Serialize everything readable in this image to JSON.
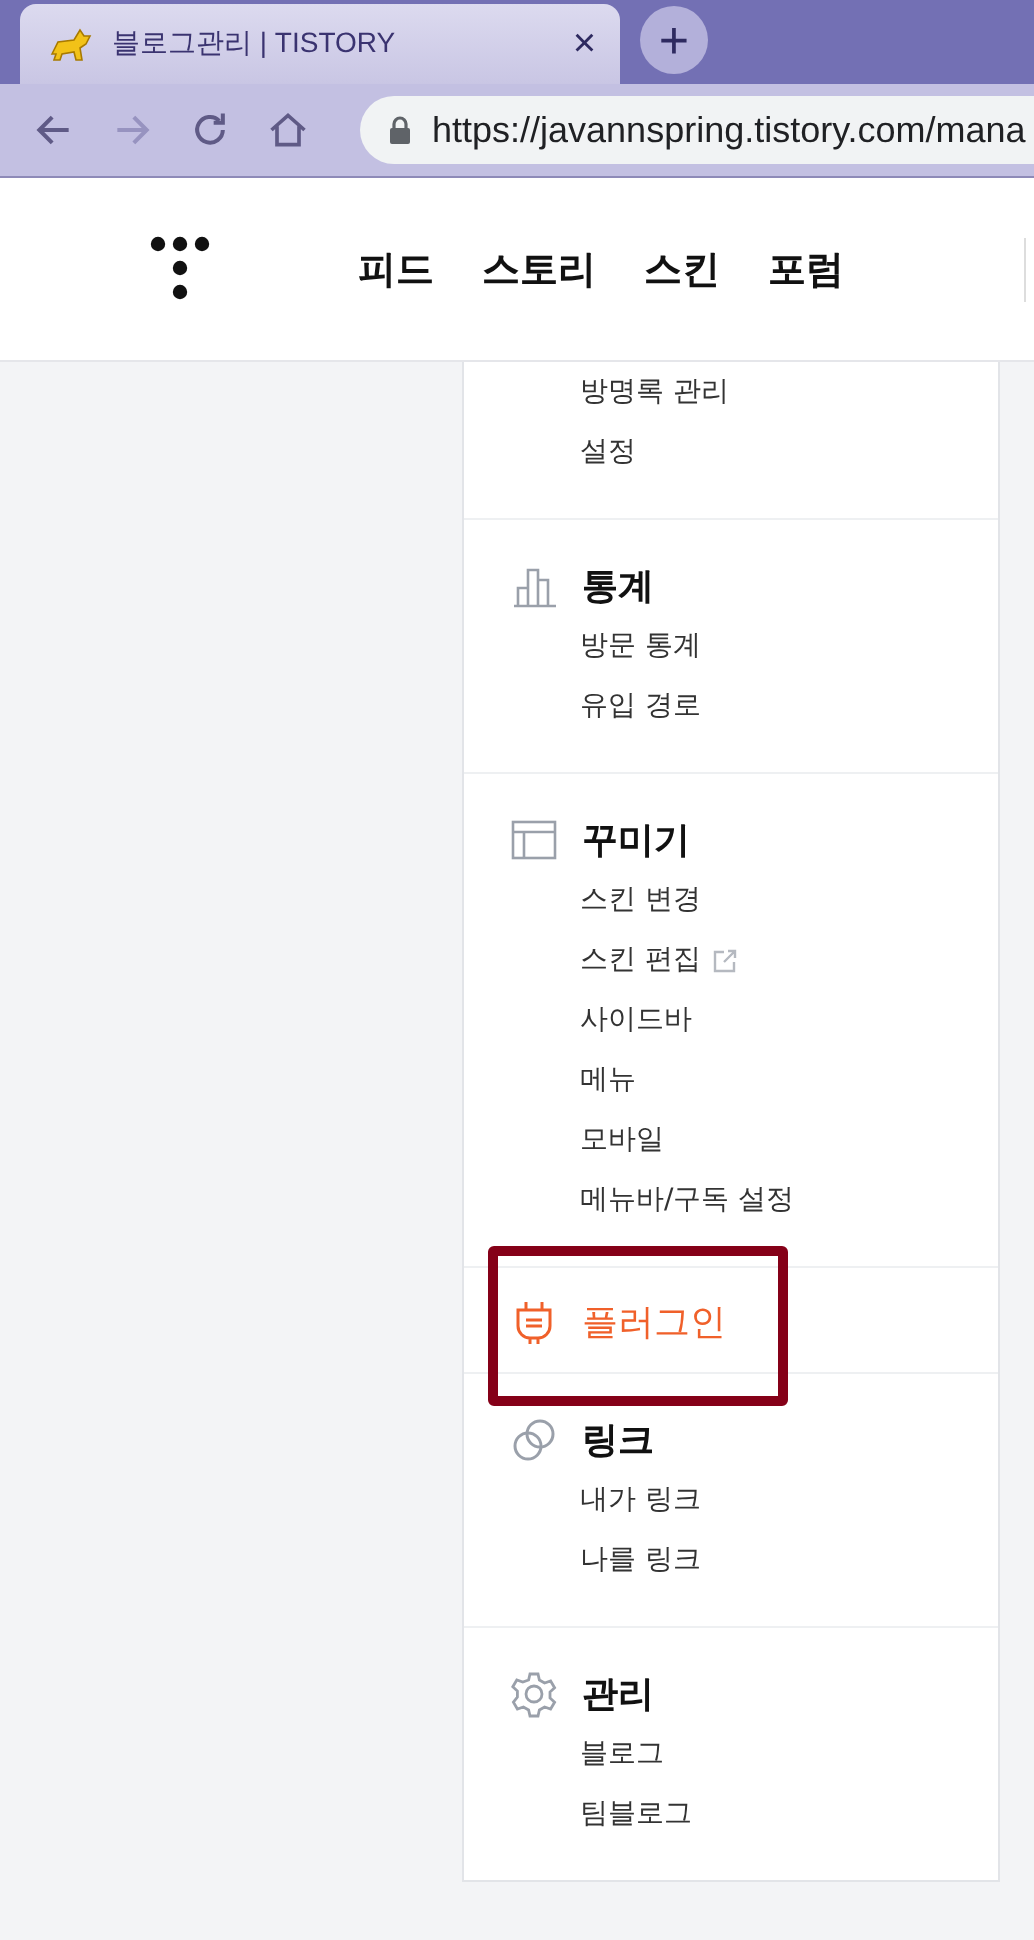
{
  "browser": {
    "tab_title": "블로그관리 | TISTORY",
    "close": "×",
    "new_tab": "+",
    "url": "https://javannspring.tistory.com/mana"
  },
  "nav": {
    "items": [
      "피드",
      "스토리",
      "스킨",
      "포럼"
    ]
  },
  "sidebar": {
    "sections": [
      {
        "kind": "partial",
        "selected": false,
        "highlighted": false,
        "items": [
          {
            "label": "방명록 관리",
            "external": false
          },
          {
            "label": "설정",
            "external": false
          }
        ]
      },
      {
        "kind": "stats",
        "title": "통계",
        "selected": false,
        "highlighted": false,
        "items": [
          {
            "label": "방문 통계",
            "external": false
          },
          {
            "label": "유입 경로",
            "external": false
          }
        ]
      },
      {
        "kind": "design",
        "title": "꾸미기",
        "selected": false,
        "highlighted": false,
        "items": [
          {
            "label": "스킨 변경",
            "external": false
          },
          {
            "label": "스킨 편집",
            "external": true
          },
          {
            "label": "사이드바",
            "external": false
          },
          {
            "label": "메뉴",
            "external": false
          },
          {
            "label": "모바일",
            "external": false
          },
          {
            "label": "메뉴바/구독 설정",
            "external": false
          }
        ]
      },
      {
        "kind": "plugin",
        "title": "플러그인",
        "selected": true,
        "highlighted": true
      },
      {
        "kind": "link",
        "title": "링크",
        "selected": false,
        "highlighted": false,
        "items": [
          {
            "label": "내가 링크",
            "external": false
          },
          {
            "label": "나를 링크",
            "external": false
          }
        ]
      },
      {
        "kind": "manage",
        "title": "관리",
        "selected": false,
        "highlighted": false,
        "items": [
          {
            "label": "블로그",
            "external": false
          },
          {
            "label": "팀블로그",
            "external": false
          }
        ]
      }
    ]
  }
}
